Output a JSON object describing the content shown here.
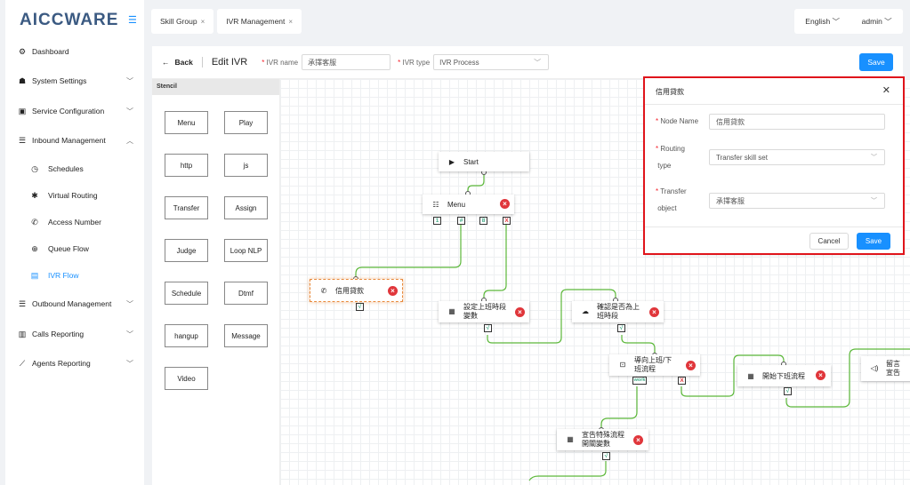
{
  "app": {
    "logo": "AICCWARE"
  },
  "sidebar": {
    "items": [
      {
        "label": "Dashboard",
        "icon": "dashboard-icon",
        "glyph": "⚙"
      },
      {
        "label": "System Settings",
        "icon": "users-icon",
        "glyph": "👥"
      },
      {
        "label": "Service Configuration",
        "icon": "id-card-icon",
        "glyph": "▣"
      },
      {
        "label": "Inbound Management",
        "icon": "list-icon",
        "glyph": "☰"
      },
      {
        "label": "Schedules",
        "icon": "clock-icon",
        "glyph": "◷"
      },
      {
        "label": "Virtual Routing",
        "icon": "gear-icon",
        "glyph": "✱"
      },
      {
        "label": "Access Number",
        "icon": "phone-icon",
        "glyph": "✆"
      },
      {
        "label": "Queue Flow",
        "icon": "queue-icon",
        "glyph": "⊕"
      },
      {
        "label": "IVR Flow",
        "icon": "film-icon",
        "glyph": "▤"
      },
      {
        "label": "Outbound Management",
        "icon": "list-icon",
        "glyph": "☰"
      },
      {
        "label": "Calls Reporting",
        "icon": "bar-chart-icon",
        "glyph": "▥"
      },
      {
        "label": "Agents Reporting",
        "icon": "line-chart-icon",
        "glyph": "⟋"
      }
    ]
  },
  "tabs": [
    {
      "label": "Skill Group",
      "close": "×"
    },
    {
      "label": "IVR Management",
      "close": "×"
    }
  ],
  "header": {
    "language": "English",
    "user": "admin"
  },
  "toolbar": {
    "back": "Back",
    "title": "Edit IVR",
    "name_label": "IVR name",
    "name_value": "承擇客服",
    "type_label": "IVR type",
    "type_value": "IVR Process",
    "save": "Save"
  },
  "stencil": {
    "title": "Stencil",
    "items": [
      "Menu",
      "Play",
      "http",
      "js",
      "Transfer",
      "Assign",
      "Judge",
      "Loop NLP",
      "Schedule",
      "Dtmf",
      "hangup",
      "Message",
      "Video"
    ]
  },
  "nodes": {
    "start": "Start",
    "menu": "Menu",
    "menu_ports": [
      "1",
      "#",
      "8",
      "X"
    ],
    "credit": "信用貸款",
    "set_var": "設定上班時段\n變數",
    "confirm": "確認是否為上\n班時段",
    "guide": "導向上班/下\n班流程",
    "start_off": "開始下班流程",
    "leave": "留言\n宣告",
    "announce": "宣告特殊流程\n開關變數",
    "port_ok": "√",
    "port_x": "X",
    "port_work": "work"
  },
  "panel": {
    "title": "信用貸款",
    "close": "✕",
    "node_name_label": "Node Name",
    "node_name_value": "信用貸款",
    "routing_label_1": "Routing",
    "routing_label_2": "type",
    "routing_value": "Transfer skill set",
    "transfer_label_1": "Transfer",
    "transfer_label_2": "object",
    "transfer_value": "承擇客服",
    "cancel": "Cancel",
    "save": "Save"
  },
  "colors": {
    "accent": "#1890ff",
    "link": "#52c41a",
    "danger": "#e0363b",
    "highlight": "#e0141b"
  }
}
